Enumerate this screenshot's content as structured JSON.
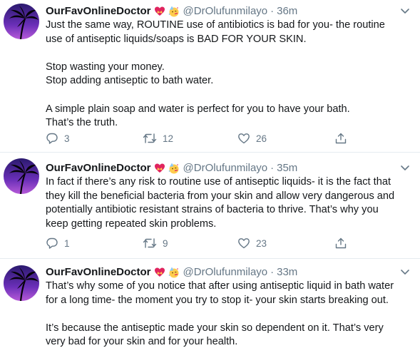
{
  "tweets": [
    {
      "name": "OurFavOnlineDoctor",
      "handle": "@DrOlufunmilayo",
      "separator": "·",
      "time": "36m",
      "lines": [
        "Just the same way, ROUTINE use of antibiotics is bad for you- the routine",
        "use of antiseptic liquids/soaps is BAD FOR YOUR SKIN.",
        "",
        "Stop wasting your money.",
        "Stop adding antiseptic to bath water.",
        "",
        "A simple plain soap and water is perfect for you to have your bath.",
        "That’s the truth."
      ],
      "replies": "3",
      "retweets": "12",
      "likes": "26"
    },
    {
      "name": "OurFavOnlineDoctor",
      "handle": "@DrOlufunmilayo",
      "separator": "·",
      "time": "35m",
      "lines": [
        "In fact if there’s any risk to routine use of antiseptic liquids- it is the fact that",
        "they kill the beneficial bacteria from your skin and allow very dangerous and",
        "potentially antibiotic resistant strains of bacteria to thrive. That’s why you",
        "keep getting repeated skin problems."
      ],
      "replies": "1",
      "retweets": "9",
      "likes": "23"
    },
    {
      "name": "OurFavOnlineDoctor",
      "handle": "@DrOlufunmilayo",
      "separator": "·",
      "time": "33m",
      "lines": [
        "That’s why some of you notice that after using antiseptic liquid in bath water",
        "for a long time- the moment you try to stop it- your skin starts breaking out.",
        "",
        "It’s because the antiseptic made your skin so dependent on it. That’s very",
        "very bad for your skin and for your health."
      ]
    }
  ],
  "icons": {
    "avatar": "palm-tree-sunset-avatar",
    "emoji_1": "heart-with-ribbon-emoji",
    "emoji_2": "partying-face-emoji",
    "caret": "chevron-down-icon",
    "reply": "reply-icon",
    "retweet": "retweet-icon",
    "like": "heart-icon",
    "share": "share-icon"
  },
  "colors": {
    "text": "#14171a",
    "secondary": "#657786",
    "divider": "#e6ecf0",
    "avatar_bg_top": "#2b1a6e",
    "avatar_bg_bottom": "#9b3fd6"
  }
}
